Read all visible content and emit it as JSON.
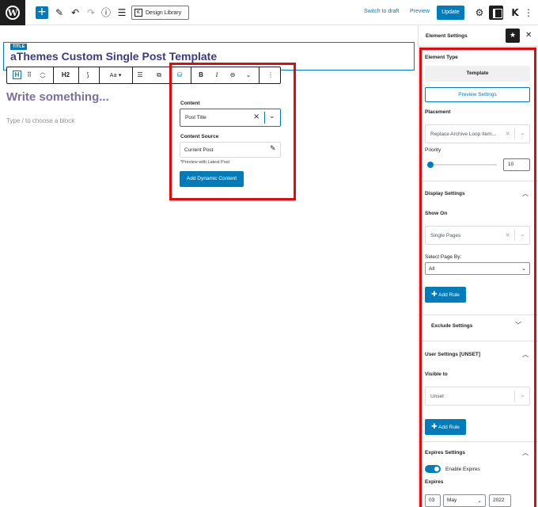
{
  "topbar": {
    "design_library": "Design Library",
    "switch_to_draft": "Switch to draft",
    "preview": "Preview",
    "update": "Update"
  },
  "editor": {
    "title_label": "TITLE",
    "post_title": "aThemes Custom Single Post Template",
    "heading_level": "H2",
    "write_placeholder": "Write something...",
    "type_hint": "Type / to choose a block"
  },
  "dynamic_popover": {
    "content_label": "Content",
    "content_value": "Post Title",
    "source_label": "Content Source",
    "source_value": "Current Post",
    "preview_note": "*Preview with Latest Post",
    "add_button": "Add Dynamic Content"
  },
  "sidebar": {
    "header_title": "Element Settings",
    "element_type_label": "Element Type",
    "element_type_value": "Template",
    "preview_settings": "Preview Settings",
    "placement_label": "Placement",
    "placement_value": "Replace Archive Loop Item...",
    "priority_label": "Priority",
    "priority_value": "10",
    "priority_fraction": 0.04,
    "display_settings": "Display Settings",
    "show_on_label": "Show On",
    "show_on_value": "Single Pages",
    "select_page_by_label": "Select Page By:",
    "select_page_by_value": "All",
    "add_rule": "Add Rule",
    "exclude_settings": "Exclude Settings",
    "user_settings": "User Settings [UNSET]",
    "visible_to_label": "Visible to",
    "visible_to_value": "Unset",
    "expires_settings": "Expires Settings",
    "enable_expires": "Enable Expires",
    "expires_label": "Expires",
    "expires_day": "03",
    "expires_month": "May",
    "expires_year": "2022"
  },
  "colors": {
    "accent": "#007cba",
    "highlight": "#e20a0a",
    "title_text": "#3b3b84"
  }
}
